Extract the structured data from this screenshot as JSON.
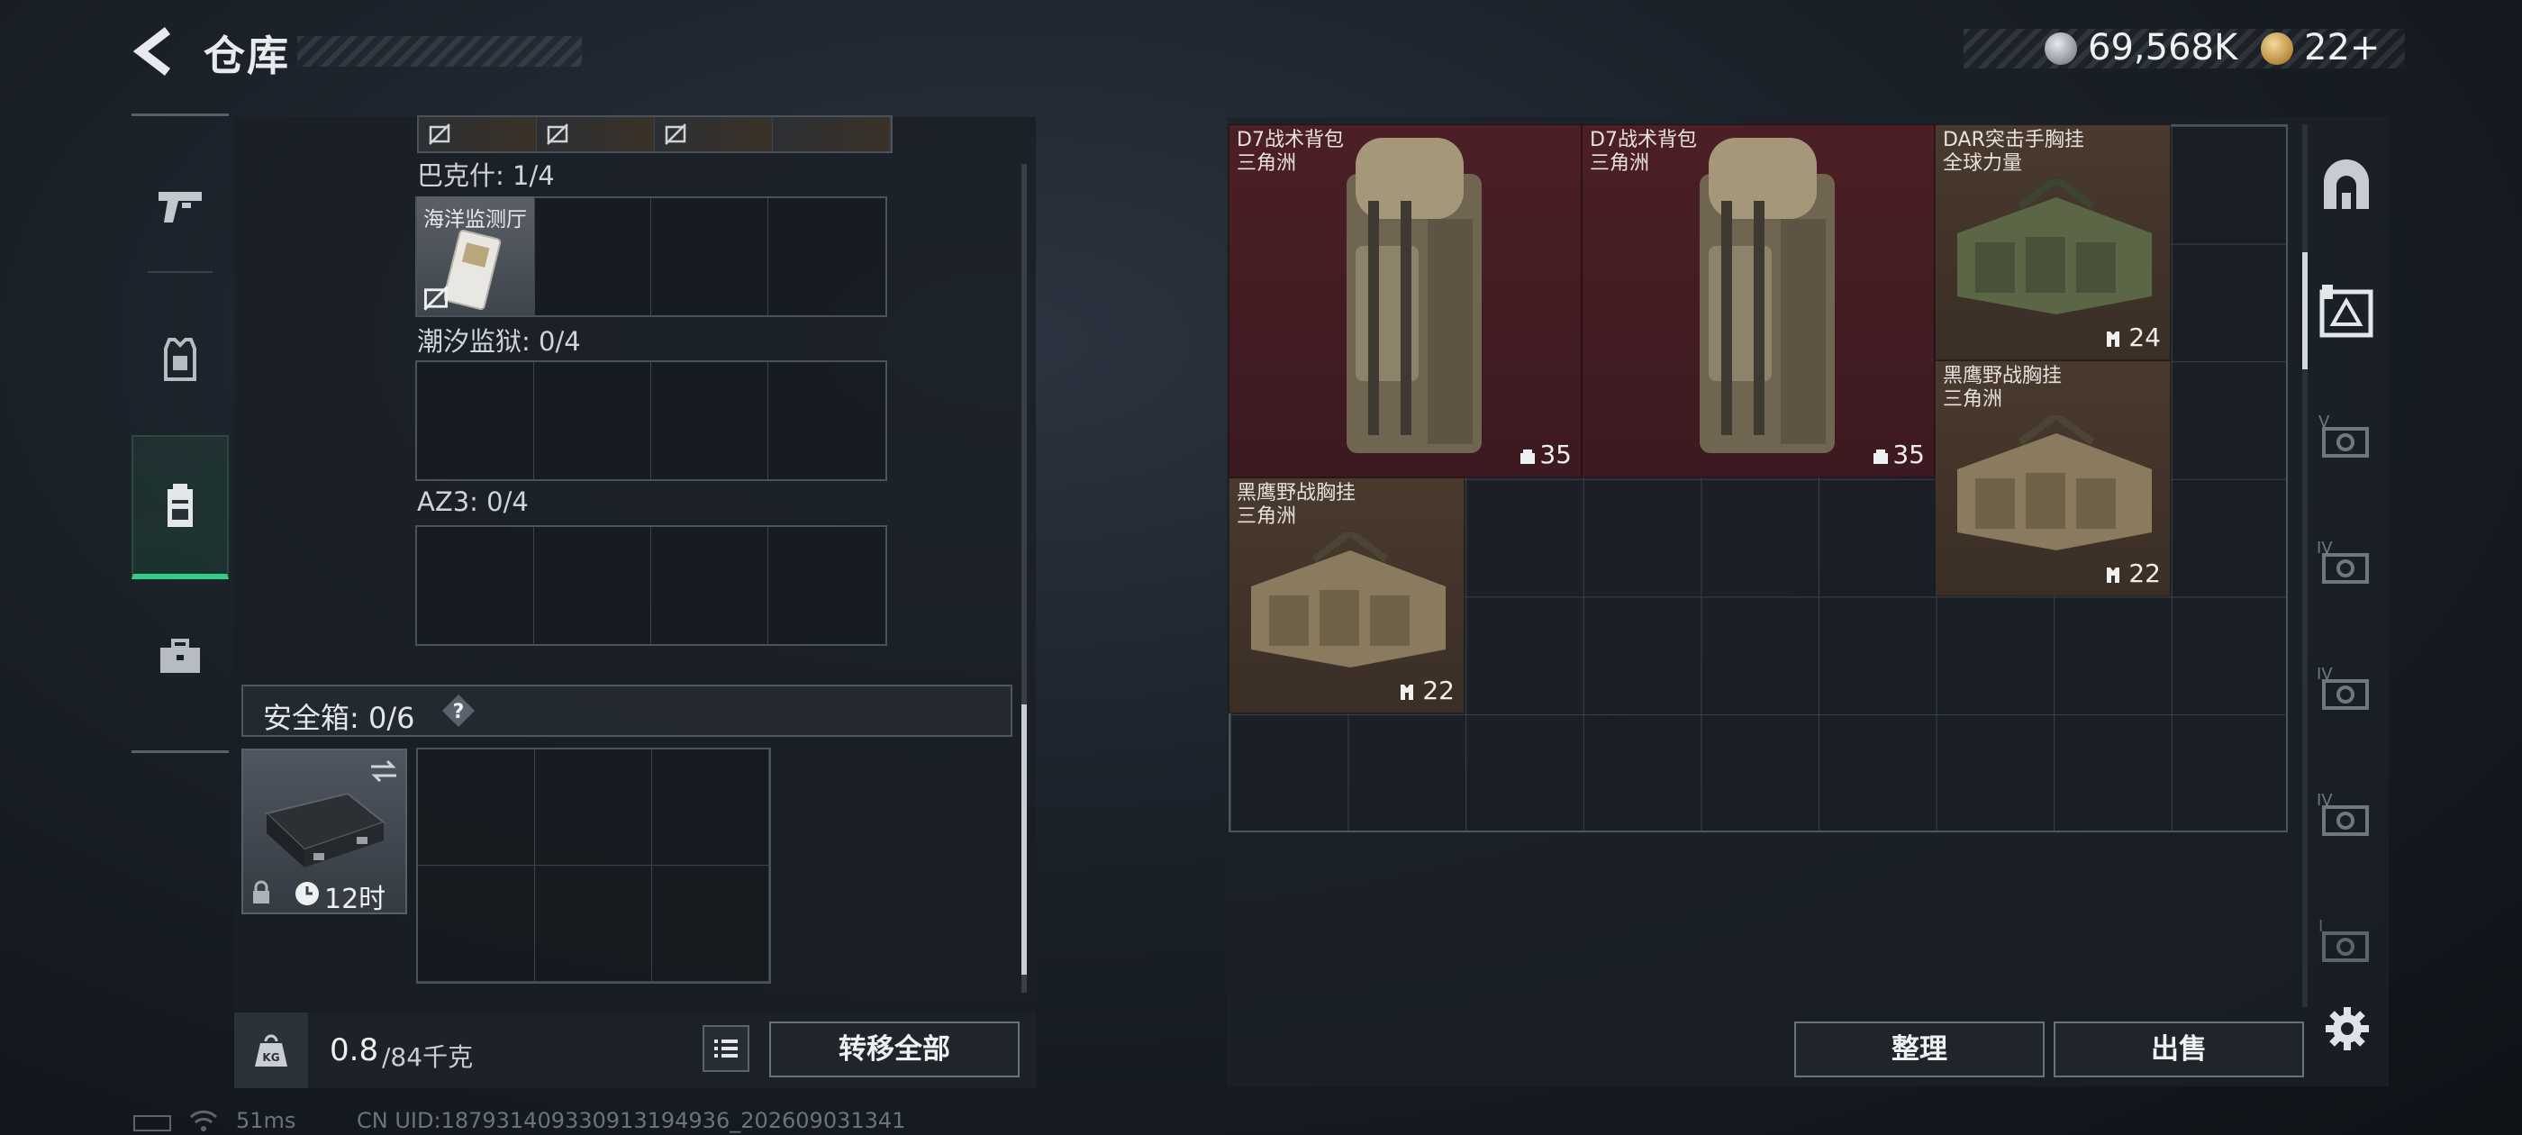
{
  "header": {
    "title": "仓库",
    "silver_amount": "69,568K",
    "gold_amount": "22+"
  },
  "left_rail": {
    "items": [
      {
        "name": "weapons",
        "icon": "pistol-icon"
      },
      {
        "name": "armor",
        "icon": "armor-icon"
      },
      {
        "name": "backpack",
        "icon": "backpack-icon",
        "active": true
      },
      {
        "name": "cases",
        "icon": "briefcase-icon"
      }
    ]
  },
  "containers": {
    "bakeshi_label": "巴克什: 1/4",
    "card_name": "海洋监测厅",
    "chaoxi_label": "潮汐监狱: 0/4",
    "az3_label": "AZ3: 0/4"
  },
  "safe_box": {
    "label": "安全箱: 0/6",
    "help": "?",
    "time_left": "12时"
  },
  "footer": {
    "weight_icon_text": "KG",
    "weight_value": "0.8",
    "weight_cap": "/84千克",
    "transfer_label": "转移全部",
    "sort_label": "整理",
    "sell_label": "出售"
  },
  "stash_items": [
    {
      "name": "D7战术背包",
      "sub": "三角洲",
      "count": "35",
      "count_icon": "backpack-small-icon"
    },
    {
      "name": "D7战术背包",
      "sub": "三角洲",
      "count": "35",
      "count_icon": "backpack-small-icon"
    },
    {
      "name": "DAR突击手胸挂",
      "sub": "全球力量",
      "count": "24",
      "count_icon": "vest-small-icon"
    },
    {
      "name": "黑鹰野战胸挂",
      "sub": "三角洲",
      "count": "22",
      "count_icon": "vest-small-icon"
    },
    {
      "name": "黑鹰野战胸挂",
      "sub": "三角洲",
      "count": "22",
      "count_icon": "vest-small-icon"
    }
  ],
  "right_rail": {
    "tabs": [
      "home-icon",
      "inventory-tier-icon",
      "tier-v-icon",
      "tier-iv-icon",
      "tier-iv-icon",
      "tier-iv-icon",
      "tier-i-icon"
    ]
  },
  "status": {
    "ping": "51ms",
    "uid": "CN UID:18793140933091319493​6_202609031341"
  },
  "colors": {
    "accent_green": "#2fd08a",
    "item_maroon": "#4b1f25",
    "item_brown": "#4a3a2e"
  }
}
